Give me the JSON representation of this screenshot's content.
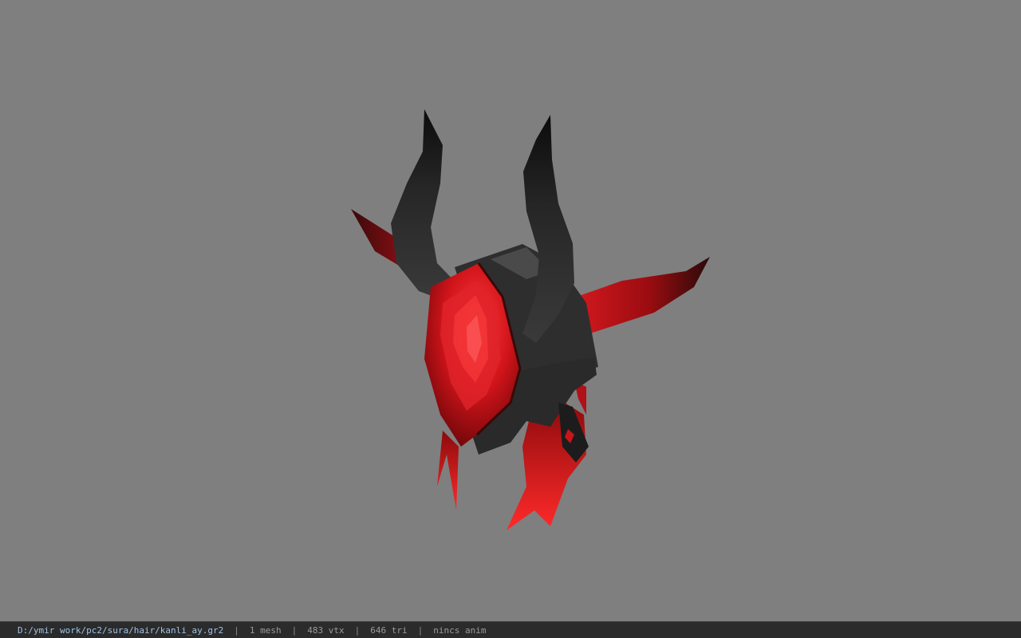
{
  "viewport": {
    "background": "#7f7f7f",
    "model": "horned-helmet-mesh",
    "accent": "#c8141a",
    "dark": "#262626"
  },
  "status": {
    "path": "D:/ymir work/pc2/sura/hair/kanli_ay.gr2",
    "mesh": "1 mesh",
    "vtx": "483 vtx",
    "tri": "646 tri",
    "anim": "nincs anim",
    "separator": "|"
  }
}
